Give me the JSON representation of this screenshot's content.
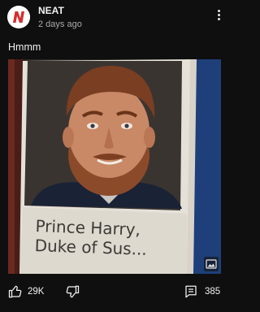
{
  "post": {
    "channel_name": "NEAT",
    "time_ago": "2 days ago",
    "text": "Hmmm",
    "avatar_letter": "N",
    "brand_color": "#d32f2f"
  },
  "image": {
    "caption_line1": "Prince Harry,",
    "caption_line2": "Duke of Sus..."
  },
  "actions": {
    "likes": "29K",
    "comments": "385",
    "icons": [
      "thumbs-up-icon",
      "thumbs-down-icon",
      "comment-icon",
      "more-vert-icon",
      "image-icon"
    ]
  }
}
